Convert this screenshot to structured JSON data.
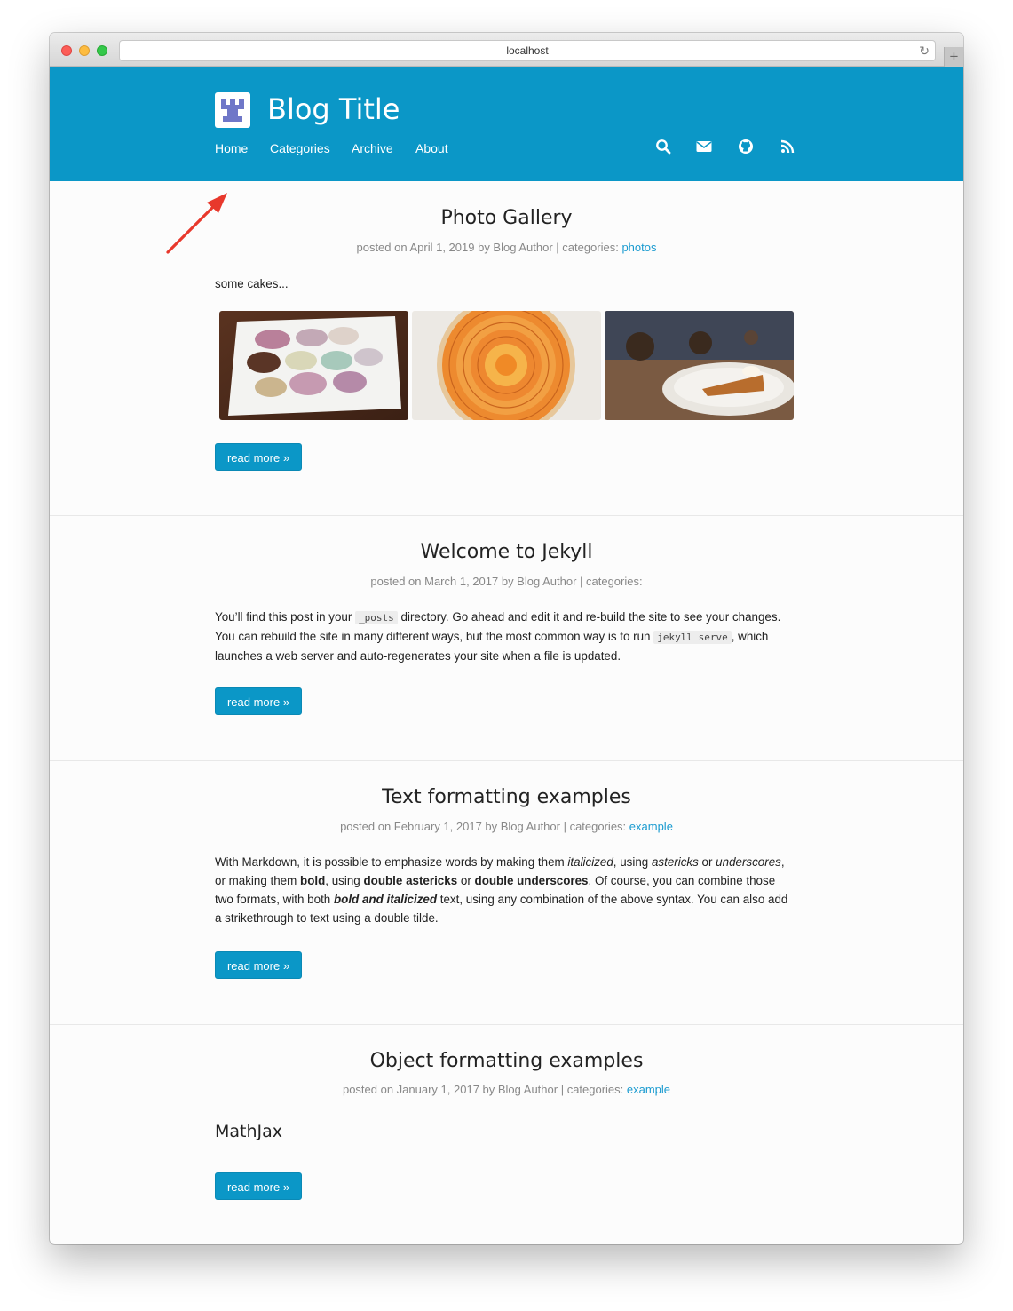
{
  "browser": {
    "url": "localhost",
    "reload_icon": "reload-icon",
    "newtab_label": "+"
  },
  "header": {
    "blog_title": "Blog Title",
    "logo_icon": "site-logo-icon",
    "nav": [
      {
        "label": "Home"
      },
      {
        "label": "Categories"
      },
      {
        "label": "Archive"
      },
      {
        "label": "About"
      }
    ],
    "icons": [
      "search-icon",
      "mail-icon",
      "github-icon",
      "rss-icon"
    ],
    "background_color": "#0b97c7"
  },
  "posts": [
    {
      "title": "Photo Gallery",
      "meta_prefix": "posted on April 1, 2019 by Blog Author | categories: ",
      "category": "photos",
      "excerpt": "some cakes...",
      "gallery": [
        "macarons-photo",
        "orange-tart-photo",
        "pumpkin-pie-photo"
      ],
      "read_more": "read more »"
    },
    {
      "title": "Welcome to Jekyll",
      "meta_prefix": "posted on March 1, 2017 by Blog Author | categories:",
      "category": "",
      "excerpt_parts": {
        "a": "You’ll find this post in your ",
        "code1": "_posts",
        "b": " directory. Go ahead and edit it and re-build the site to see your changes. You can rebuild the site in many different ways, but the most common way is to run ",
        "code2": "jekyll serve",
        "c": ", which launches a web server and auto-regenerates your site when a file is updated."
      },
      "read_more": "read more »"
    },
    {
      "title": "Text formatting examples",
      "meta_prefix": "posted on February 1, 2017 by Blog Author | categories: ",
      "category": "example",
      "excerpt_parts": {
        "a": "With Markdown, it is possible to emphasize words by making them ",
        "i1": "italicized",
        "b": ", using ",
        "i2": "astericks",
        "c": " or ",
        "i3": "underscores",
        "d": ", or making them ",
        "b1": "bold",
        "e": ", using ",
        "b2": "double astericks",
        "f": " or ",
        "b3": "double underscores",
        "g": ". Of course, you can combine those two formats, with both ",
        "bi": "bold and italicized",
        "h": " text, using any combination of the above syntax. You can also add a strikethrough to text using a ",
        "s": "double tilde",
        "i": "."
      },
      "read_more": "read more »"
    },
    {
      "title": "Object formatting examples",
      "meta_prefix": "posted on January 1, 2017 by Blog Author | categories: ",
      "category": "example",
      "heading": "MathJax",
      "read_more": "read more »"
    }
  ]
}
